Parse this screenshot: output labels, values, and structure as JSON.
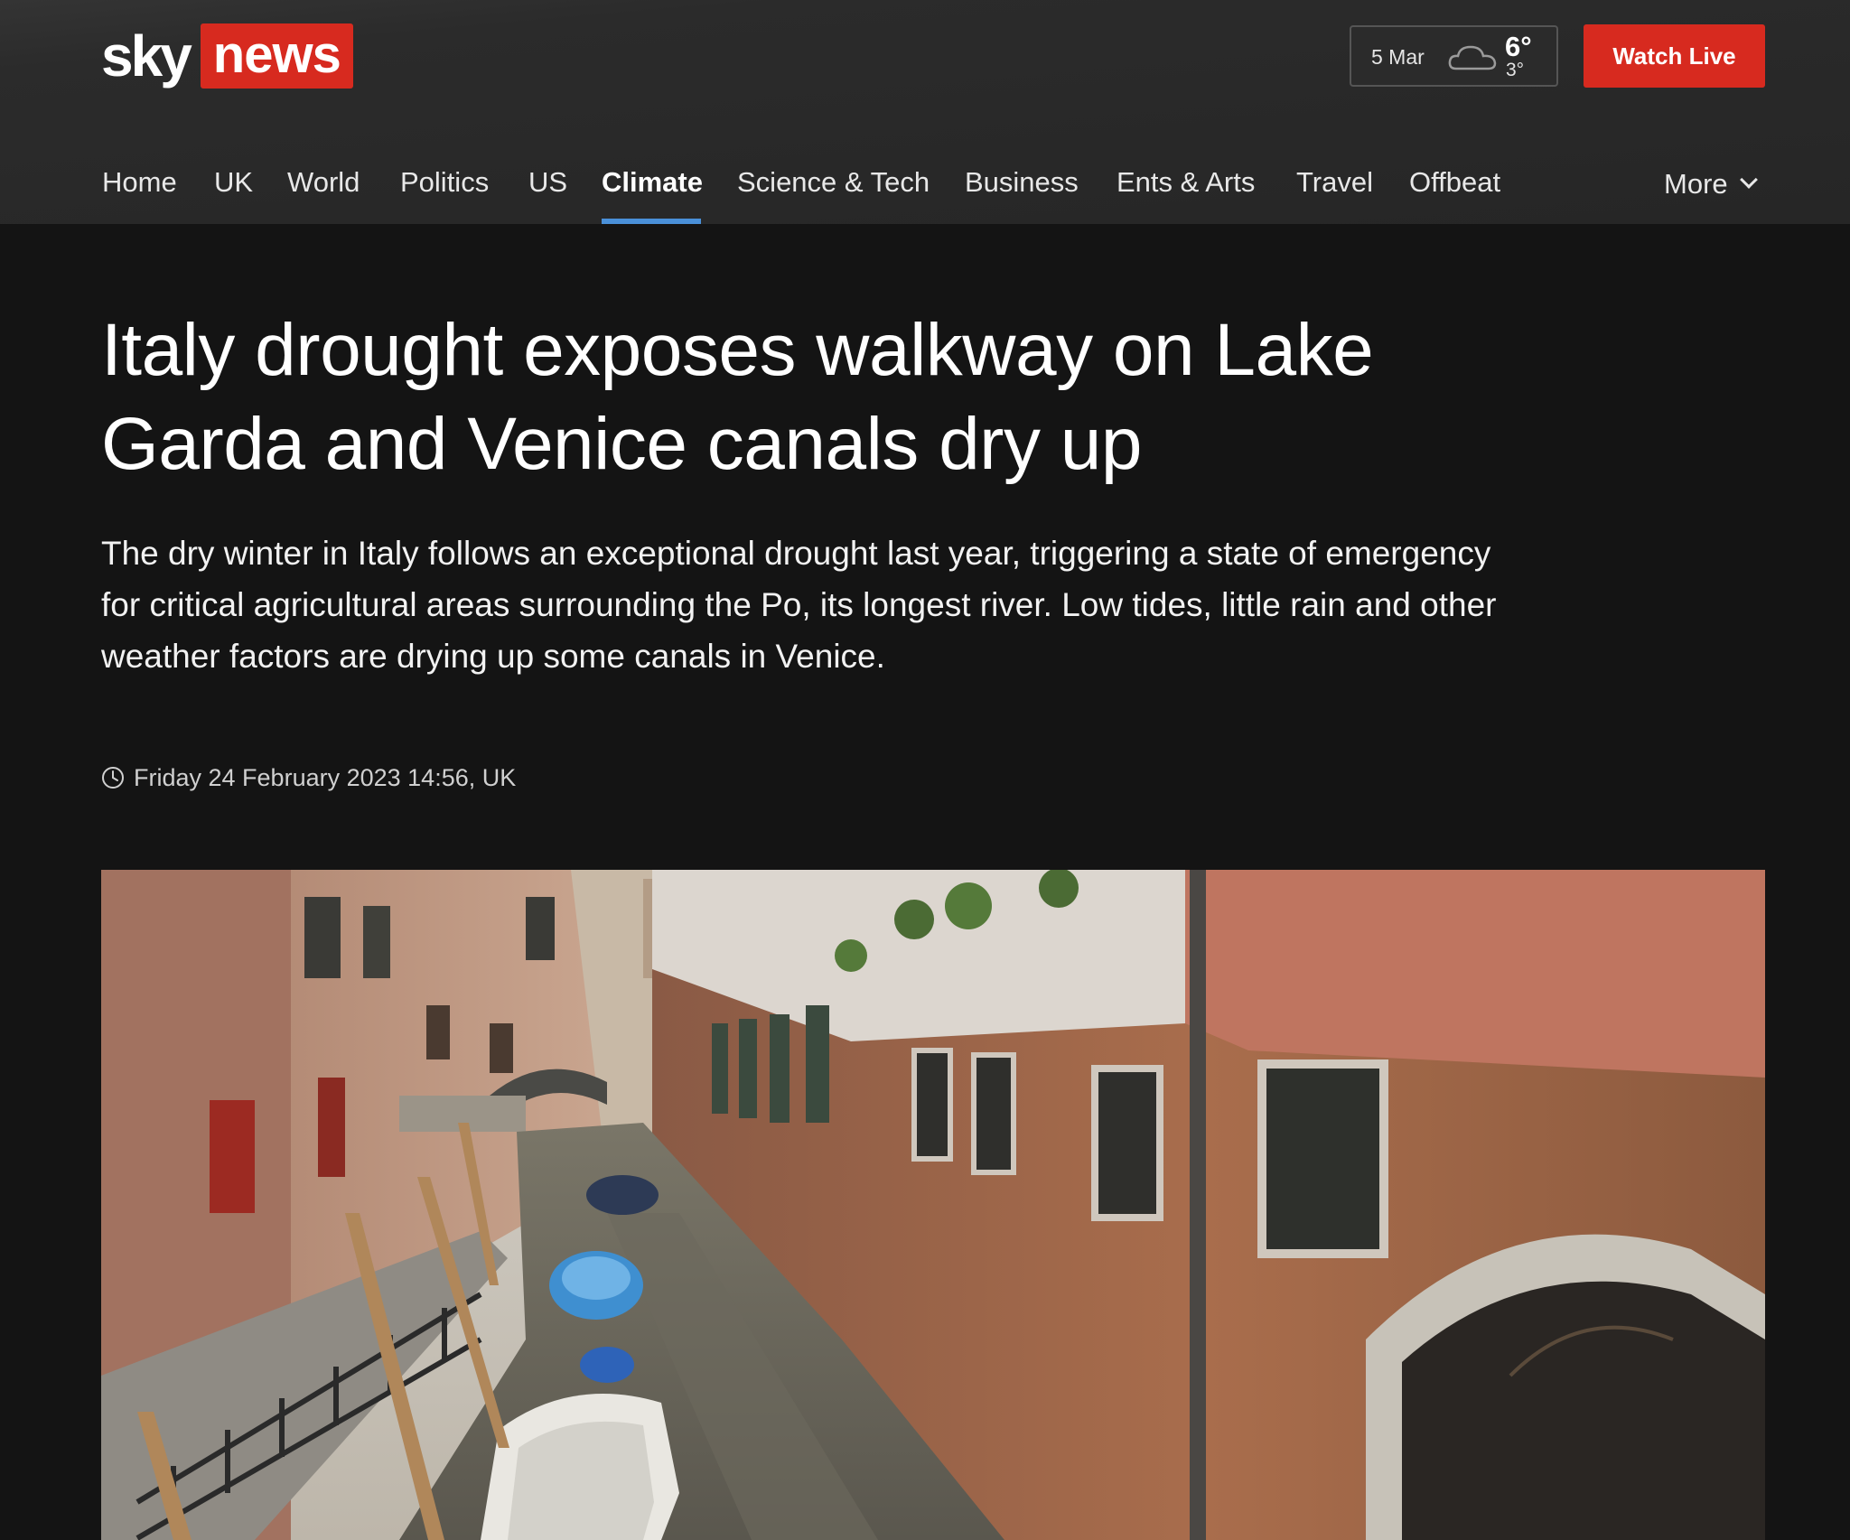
{
  "header": {
    "logo_sky": "sky",
    "logo_news": "news",
    "weather": {
      "date": "5 Mar",
      "high": "6°",
      "low": "3°",
      "icon": "cloud-icon"
    },
    "watch_live_label": "Watch Live"
  },
  "nav": {
    "items": [
      {
        "label": "Home"
      },
      {
        "label": "UK"
      },
      {
        "label": "World"
      },
      {
        "label": "Politics"
      },
      {
        "label": "US"
      },
      {
        "label": "Climate",
        "active": true
      },
      {
        "label": "Science & Tech"
      },
      {
        "label": "Business"
      },
      {
        "label": "Ents & Arts"
      },
      {
        "label": "Travel"
      },
      {
        "label": "Offbeat"
      }
    ],
    "more_label": "More",
    "active_color": "#4a90d9"
  },
  "article": {
    "headline": "Italy drought exposes walkway on Lake Garda and Venice canals dry up",
    "standfirst": "The dry winter in Italy follows an exceptional drought last year, triggering a state of emergency for critical agricultural areas surrounding the Po, its longest river. Low tides, little rain and other weather factors are drying up some canals in Venice.",
    "timestamp": "Friday 24 February 2023 14:56, UK"
  },
  "colors": {
    "brand_red": "#d72a1f",
    "background": "#141414",
    "header_bg": "#2a2a2a"
  }
}
